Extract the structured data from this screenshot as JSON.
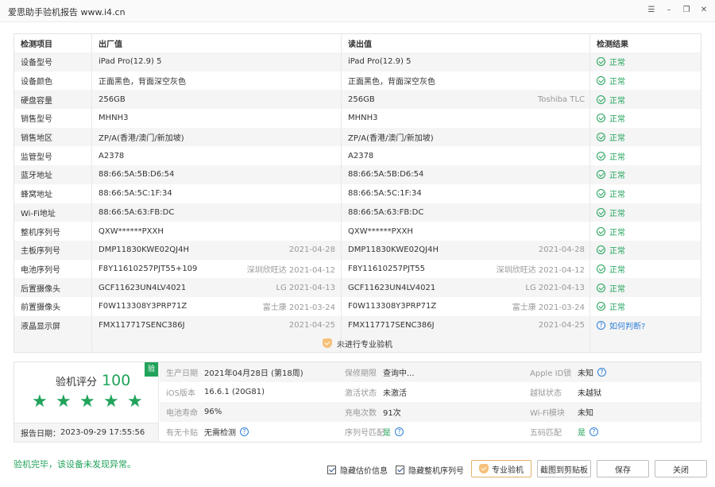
{
  "window": {
    "title": "爱思助手验机报告 www.i4.cn",
    "controls": [
      "menu-icon",
      "minimize-icon",
      "restore-icon",
      "close-icon"
    ]
  },
  "table": {
    "headers": [
      "检测项目",
      "出厂值",
      "读出值",
      "检测结果"
    ],
    "rows": [
      {
        "item": "设备型号",
        "factory": "iPad Pro(12.9) 5",
        "factory_sub": "",
        "read": "iPad Pro(12.9) 5",
        "read_sub": "",
        "result": "正常"
      },
      {
        "item": "设备颜色",
        "factory": "正面黑色，背面深空灰色",
        "factory_sub": "",
        "read": "正面黑色，背面深空灰色",
        "read_sub": "",
        "result": "正常"
      },
      {
        "item": "硬盘容量",
        "factory": "256GB",
        "factory_sub": "",
        "read": "256GB",
        "read_sub": "Toshiba TLC",
        "result": "正常"
      },
      {
        "item": "销售型号",
        "factory": "MHNH3",
        "factory_sub": "",
        "read": "MHNH3",
        "read_sub": "",
        "result": "正常"
      },
      {
        "item": "销售地区",
        "factory": "ZP/A(香港/澳门/新加坡)",
        "factory_sub": "",
        "read": "ZP/A(香港/澳门/新加坡)",
        "read_sub": "",
        "result": "正常"
      },
      {
        "item": "监管型号",
        "factory": "A2378",
        "factory_sub": "",
        "read": "A2378",
        "read_sub": "",
        "result": "正常"
      },
      {
        "item": "蓝牙地址",
        "factory": "88:66:5A:5B:D6:54",
        "factory_sub": "",
        "read": "88:66:5A:5B:D6:54",
        "read_sub": "",
        "result": "正常"
      },
      {
        "item": "蜂窝地址",
        "factory": "88:66:5A:5C:1F:34",
        "factory_sub": "",
        "read": "88:66:5A:5C:1F:34",
        "read_sub": "",
        "result": "正常"
      },
      {
        "item": "Wi-Fi地址",
        "factory": "88:66:5A:63:FB:DC",
        "factory_sub": "",
        "read": "88:66:5A:63:FB:DC",
        "read_sub": "",
        "result": "正常"
      },
      {
        "item": "整机序列号",
        "factory": "QXW******PXXH",
        "factory_sub": "",
        "read": "QXW******PXXH",
        "read_sub": "",
        "result": "正常"
      },
      {
        "item": "主板序列号",
        "factory": "DMP11830KWE02QJ4H",
        "factory_sub": "2021-04-28",
        "read": "DMP11830KWE02QJ4H",
        "read_sub": "2021-04-28",
        "result": "正常"
      },
      {
        "item": "电池序列号",
        "factory": "F8Y11610257PJT55+109",
        "factory_sub": "深圳欣旺达 2021-04-12",
        "read": "F8Y11610257PJT55",
        "read_sub": "深圳欣旺达 2021-04-12",
        "result": "正常"
      },
      {
        "item": "后置摄像头",
        "factory": "GCF11623UN4LV4021",
        "factory_sub": "LG 2021-04-13",
        "read": "GCF11623UN4LV4021",
        "read_sub": "LG 2021-04-13",
        "result": "正常"
      },
      {
        "item": "前置摄像头",
        "factory": "F0W113308Y3PRP71Z",
        "factory_sub": "富士康 2021-03-24",
        "read": "F0W113308Y3PRP71Z",
        "read_sub": "富士康 2021-03-24",
        "result": "正常"
      },
      {
        "item": "液晶显示屏",
        "factory": "FMX117717SENC386J",
        "factory_sub": "2021-04-25",
        "read": "FMX117717SENC386J",
        "read_sub": "2021-04-25",
        "result": "如何判断?"
      }
    ],
    "footer": "未进行专业验机"
  },
  "score": {
    "label": "验机评分",
    "value": "100",
    "badge": "验",
    "stars": 5,
    "report_date_label": "报告日期：",
    "report_date": "2023-09-29 17:55:56"
  },
  "info": [
    [
      {
        "k": "生产日期",
        "v": "2021年04月28日 (第18周)"
      },
      {
        "k": "保修期限",
        "v": "查询中..."
      },
      {
        "k": "Apple ID锁",
        "v": "未知",
        "help": true
      }
    ],
    [
      {
        "k": "iOS版本",
        "v": "16.6.1 (20G81)"
      },
      {
        "k": "激活状态",
        "v": "未激活"
      },
      {
        "k": "越狱状态",
        "v": "未越狱"
      }
    ],
    [
      {
        "k": "电池寿命",
        "v": "96%"
      },
      {
        "k": "充电次数",
        "v": "91次"
      },
      {
        "k": "Wi-Fi模块",
        "v": "未知"
      }
    ],
    [
      {
        "k": "有无卡贴",
        "v": "无需检测",
        "help": true
      },
      {
        "k": "序列号匹配",
        "v": "是",
        "help": true,
        "green": true
      },
      {
        "k": "五码匹配",
        "v": "是",
        "help": true,
        "green": true
      }
    ]
  ],
  "bottom": {
    "verdict": "验机完毕，该设备未发现异常。",
    "hide_price": "隐藏估价信息",
    "hide_serial": "隐藏整机序列号",
    "pro_check": "专业验机",
    "copy": "截图到剪贴板",
    "save": "保存",
    "close": "关闭"
  }
}
